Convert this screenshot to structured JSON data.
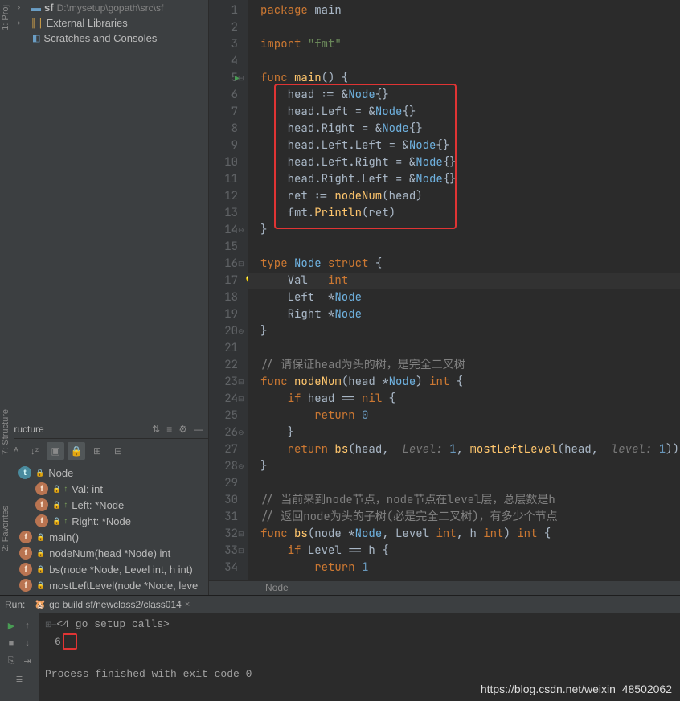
{
  "project": {
    "root_name": "sf",
    "root_path": "D:\\mysetup\\gopath\\src\\sf",
    "ext_libs": "External Libraries",
    "scratches": "Scratches and Consoles"
  },
  "structure": {
    "title": "Structure",
    "items": [
      {
        "kind": "t",
        "label": "Node",
        "chev": "⌄"
      },
      {
        "kind": "f",
        "label": "Val: int",
        "depth": 2,
        "up": true
      },
      {
        "kind": "f",
        "label": "Left: *Node",
        "depth": 2,
        "up": true
      },
      {
        "kind": "f",
        "label": "Right: *Node",
        "depth": 2,
        "up": true
      },
      {
        "kind": "f",
        "label": "main()",
        "depth": 1
      },
      {
        "kind": "f",
        "label": "nodeNum(head *Node) int",
        "depth": 1
      },
      {
        "kind": "f",
        "label": "bs(node *Node, Level int, h int)",
        "depth": 1
      },
      {
        "kind": "f",
        "label": "mostLeftLevel(node *Node, leve",
        "depth": 1
      }
    ]
  },
  "side_tabs": {
    "proj": "1: Proj",
    "struct": "7: Structure",
    "fav": "2: Favorites"
  },
  "code": {
    "lines": [
      [
        [
          "kw",
          "package "
        ],
        [
          "id",
          "main"
        ]
      ],
      [],
      [
        [
          "kw",
          "import "
        ],
        [
          "str",
          "\"fmt\""
        ]
      ],
      [],
      [
        [
          "kw",
          "func "
        ],
        [
          "fn",
          "main"
        ],
        [
          "op",
          "() {"
        ]
      ],
      [
        [
          "id",
          "    head "
        ],
        [
          "op",
          ":= &"
        ],
        [
          "typ",
          "Node"
        ],
        [
          "op",
          "{}"
        ]
      ],
      [
        [
          "id",
          "    head.Left "
        ],
        [
          "op",
          "= &"
        ],
        [
          "typ",
          "Node"
        ],
        [
          "op",
          "{}"
        ]
      ],
      [
        [
          "id",
          "    head.Right "
        ],
        [
          "op",
          "= &"
        ],
        [
          "typ",
          "Node"
        ],
        [
          "op",
          "{}"
        ]
      ],
      [
        [
          "id",
          "    head.Left.Left "
        ],
        [
          "op",
          "= &"
        ],
        [
          "typ",
          "Node"
        ],
        [
          "op",
          "{}"
        ]
      ],
      [
        [
          "id",
          "    head.Left.Right "
        ],
        [
          "op",
          "= &"
        ],
        [
          "typ",
          "Node"
        ],
        [
          "op",
          "{}"
        ]
      ],
      [
        [
          "id",
          "    head.Right.Left "
        ],
        [
          "op",
          "= &"
        ],
        [
          "typ",
          "Node"
        ],
        [
          "op",
          "{}"
        ]
      ],
      [
        [
          "id",
          "    ret "
        ],
        [
          "op",
          ":= "
        ],
        [
          "fn",
          "nodeNum"
        ],
        [
          "op",
          "(head)"
        ]
      ],
      [
        [
          "id",
          "    fmt."
        ],
        [
          "fn",
          "Println"
        ],
        [
          "op",
          "(ret)"
        ]
      ],
      [
        [
          "op",
          "}"
        ]
      ],
      [],
      [
        [
          "kw",
          "type "
        ],
        [
          "typ",
          "Node"
        ],
        [
          "kw",
          " struct"
        ],
        [
          "op",
          " {"
        ]
      ],
      [
        [
          "id",
          "    Val   "
        ],
        [
          "kw",
          "int"
        ]
      ],
      [
        [
          "id",
          "    Left  *"
        ],
        [
          "typ",
          "Node"
        ]
      ],
      [
        [
          "id",
          "    Right *"
        ],
        [
          "typ",
          "Node"
        ]
      ],
      [
        [
          "op",
          "}"
        ]
      ],
      [],
      [
        [
          "cmt",
          "// 请保证head为头的树，是完全二叉树"
        ]
      ],
      [
        [
          "kw",
          "func "
        ],
        [
          "fn",
          "nodeNum"
        ],
        [
          "op",
          "(head *"
        ],
        [
          "typ",
          "Node"
        ],
        [
          "op",
          ") "
        ],
        [
          "kw",
          "int"
        ],
        [
          "op",
          " {"
        ]
      ],
      [
        [
          "op",
          "    "
        ],
        [
          "kw",
          "if"
        ],
        [
          "id",
          " head "
        ],
        [
          "op",
          "== "
        ],
        [
          "kw",
          "nil"
        ],
        [
          "op",
          " {"
        ]
      ],
      [
        [
          "op",
          "        "
        ],
        [
          "kw",
          "return "
        ],
        [
          "num",
          "0"
        ]
      ],
      [
        [
          "op",
          "    }"
        ]
      ],
      [
        [
          "op",
          "    "
        ],
        [
          "kw",
          "return "
        ],
        [
          "fn",
          "bs"
        ],
        [
          "op",
          "(head,  "
        ],
        [
          "param",
          "Level: "
        ],
        [
          "num",
          "1"
        ],
        [
          "op",
          ", "
        ],
        [
          "fn",
          "mostLeftLevel"
        ],
        [
          "op",
          "(head,  "
        ],
        [
          "param",
          "level: "
        ],
        [
          "num",
          "1"
        ],
        [
          "op",
          "))"
        ]
      ],
      [
        [
          "op",
          "}"
        ]
      ],
      [],
      [
        [
          "cmt",
          "// 当前来到node节点，node节点在level层，总层数是h"
        ]
      ],
      [
        [
          "cmt",
          "// 返回node为头的子树(必是完全二叉树)，有多少个节点"
        ]
      ],
      [
        [
          "kw",
          "func "
        ],
        [
          "fn",
          "bs"
        ],
        [
          "op",
          "(node *"
        ],
        [
          "typ",
          "Node"
        ],
        [
          "op",
          ", Level "
        ],
        [
          "kw",
          "int"
        ],
        [
          "op",
          ", h "
        ],
        [
          "kw",
          "int"
        ],
        [
          "op",
          ") "
        ],
        [
          "kw",
          "int"
        ],
        [
          "op",
          " {"
        ]
      ],
      [
        [
          "op",
          "    "
        ],
        [
          "kw",
          "if"
        ],
        [
          "id",
          " Level "
        ],
        [
          "op",
          "== h {"
        ]
      ],
      [
        [
          "op",
          "        "
        ],
        [
          "kw",
          "return "
        ],
        [
          "num",
          "1"
        ]
      ]
    ],
    "run_line": 5,
    "bulb_line": 17,
    "highlight_line": 17,
    "fold_open": [
      5,
      16,
      23,
      24,
      32,
      33
    ],
    "fold_close": [
      14,
      20,
      26,
      28
    ]
  },
  "breadcrumb": "Node",
  "run": {
    "label": "Run:",
    "tab": "go build sf/newclass2/class014",
    "meta_line": "<4 go setup calls>",
    "output": "6",
    "finish": "Process finished with exit code 0"
  },
  "watermark": "https://blog.csdn.net/weixin_48502062"
}
